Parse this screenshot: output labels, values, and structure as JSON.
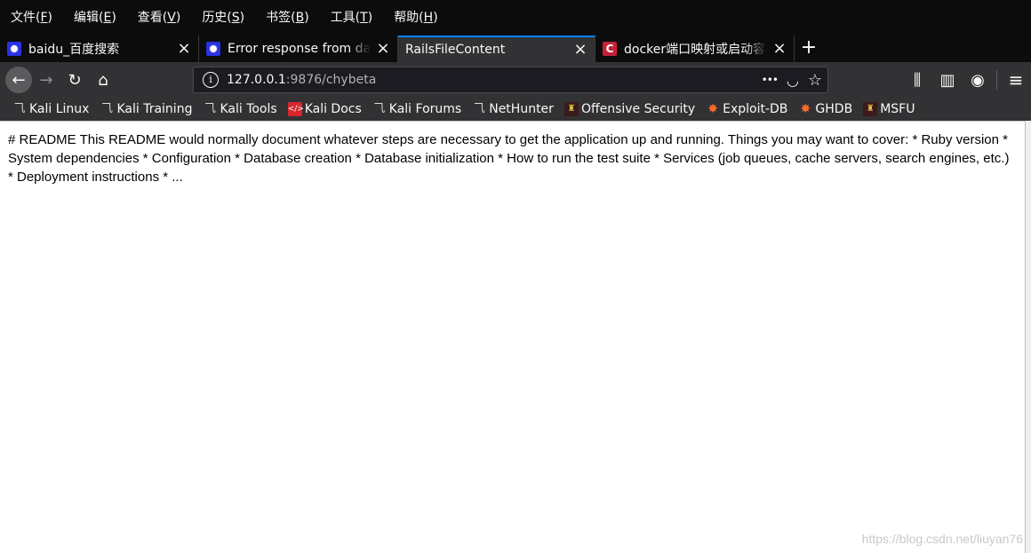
{
  "menu": [
    {
      "label": "文件(",
      "key": "F",
      "end": ")"
    },
    {
      "label": "编辑(",
      "key": "E",
      "end": ")"
    },
    {
      "label": "查看(",
      "key": "V",
      "end": ")"
    },
    {
      "label": "历史(",
      "key": "S",
      "end": ")"
    },
    {
      "label": "书签(",
      "key": "B",
      "end": ")"
    },
    {
      "label": "工具(",
      "key": "T",
      "end": ")"
    },
    {
      "label": "帮助(",
      "key": "H",
      "end": ")"
    }
  ],
  "tabs": [
    {
      "title": "baidu_百度搜索",
      "close": "×"
    },
    {
      "title": "Error response from daemon",
      "close": "×"
    },
    {
      "title": "RailsFileContent",
      "close": "×"
    },
    {
      "title": "docker端口映射或启动容器",
      "close": "×"
    }
  ],
  "newtab": "+",
  "nav": {
    "back": "←",
    "forward": "→",
    "reload": "↻",
    "home": "⌂",
    "info": "i",
    "url_host": "127.0.0.1",
    "url_path": ":9876/chybeta",
    "more": "•••",
    "pocket": "◡",
    "star": "☆",
    "library": "⫼",
    "sidebar": "▥",
    "account": "◉",
    "menu": "≡"
  },
  "bookmarks": [
    {
      "label": "Kali Linux",
      "icon": "kali-dragon-icon"
    },
    {
      "label": "Kali Training",
      "icon": "kali-dragon-icon"
    },
    {
      "label": "Kali Tools",
      "icon": "kali-dragon-icon"
    },
    {
      "label": "Kali Docs",
      "icon": "kali-docs-icon"
    },
    {
      "label": "Kali Forums",
      "icon": "kali-dragon-icon"
    },
    {
      "label": "NetHunter",
      "icon": "kali-dragon-icon"
    },
    {
      "label": "Offensive Security",
      "icon": "offsec-icon"
    },
    {
      "label": "Exploit-DB",
      "icon": "exploitdb-icon"
    },
    {
      "label": "GHDB",
      "icon": "exploitdb-icon"
    },
    {
      "label": "MSFU",
      "icon": "offsec-icon"
    }
  ],
  "content": {
    "text": "# README This README would normally document whatever steps are necessary to get the application up and running. Things you may want to cover: * Ruby version * System dependencies * Configuration * Database creation * Database initialization * How to run the test suite * Services (job queues, cache servers, search engines, etc.) * Deployment instructions * ..."
  },
  "watermark": "https://blog.csdn.net/liuyan76"
}
